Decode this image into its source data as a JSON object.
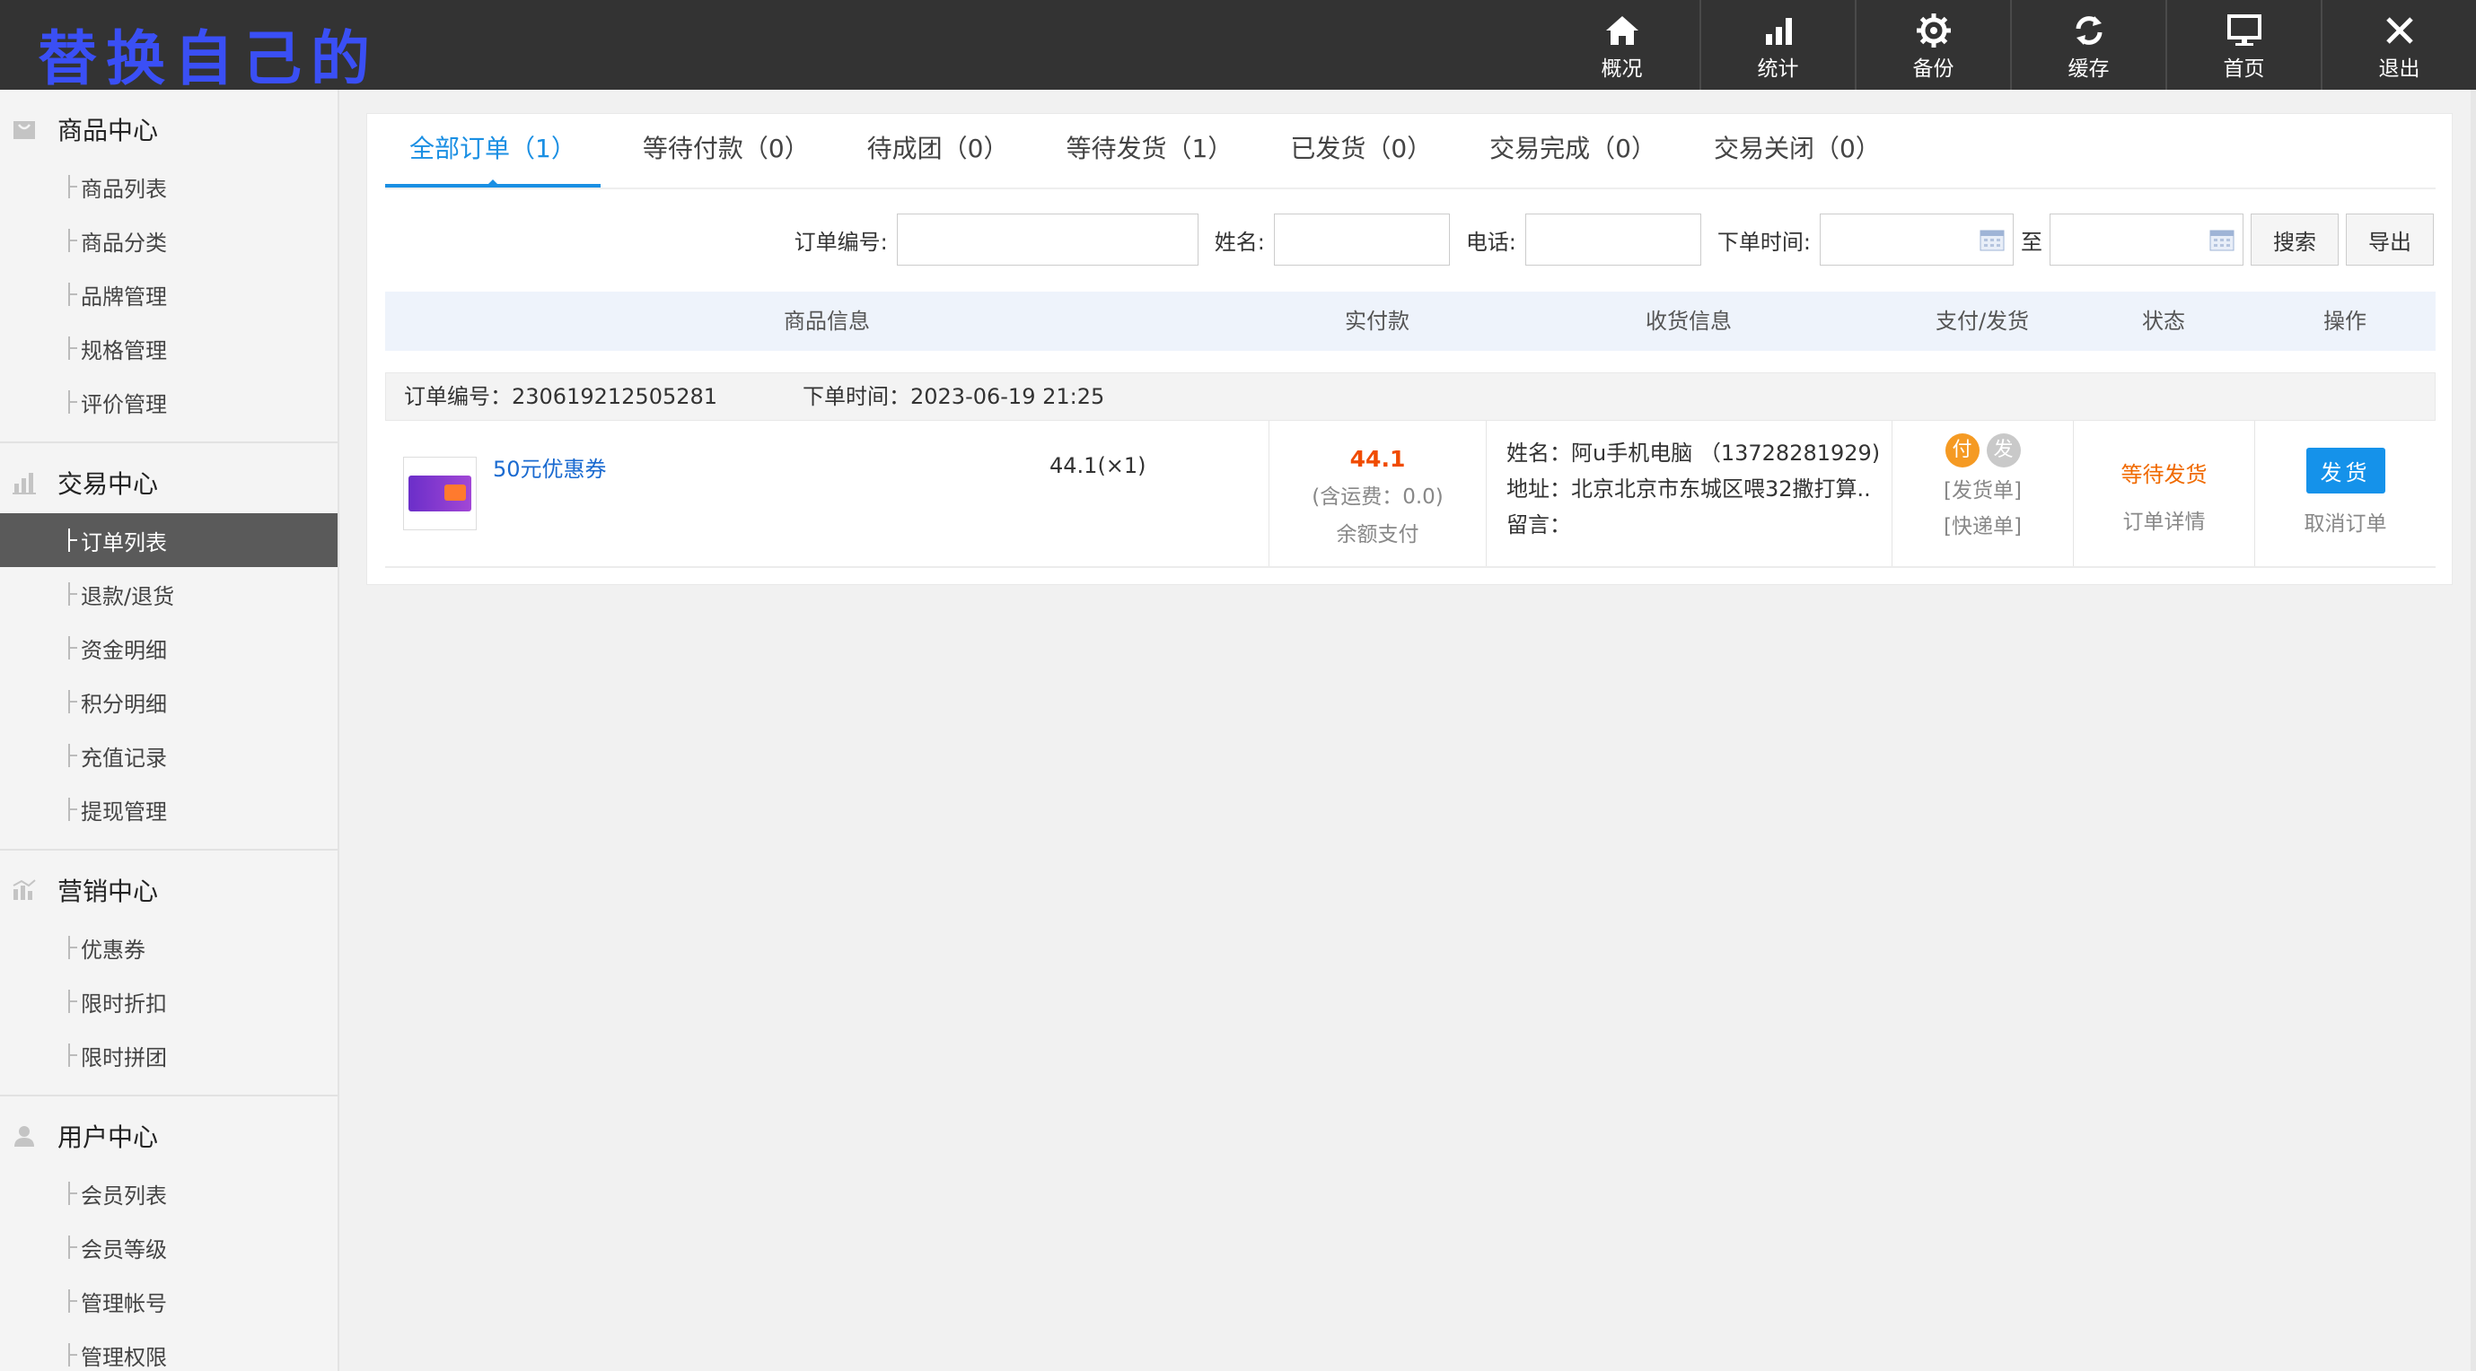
{
  "header": {
    "logo_text": "替换自己的",
    "nav": [
      {
        "label": "概况",
        "icon": "home-icon"
      },
      {
        "label": "统计",
        "icon": "bar-chart-icon"
      },
      {
        "label": "备份",
        "icon": "gear-icon"
      },
      {
        "label": "缓存",
        "icon": "refresh-icon"
      },
      {
        "label": "首页",
        "icon": "monitor-icon"
      },
      {
        "label": "退出",
        "icon": "close-icon"
      }
    ]
  },
  "sidebar": {
    "groups": [
      {
        "title": "商品中心",
        "icon": "shopping-bag-icon",
        "items": [
          "商品列表",
          "商品分类",
          "品牌管理",
          "规格管理",
          "评价管理"
        ]
      },
      {
        "title": "交易中心",
        "icon": "bar-chart-icon",
        "items": [
          "订单列表",
          "退款/退货",
          "资金明细",
          "积分明细",
          "充值记录",
          "提现管理"
        ]
      },
      {
        "title": "营销中心",
        "icon": "marketing-icon",
        "items": [
          "优惠券",
          "限时折扣",
          "限时拼团"
        ]
      },
      {
        "title": "用户中心",
        "icon": "user-icon",
        "items": [
          "会员列表",
          "会员等级",
          "管理帐号",
          "管理权限"
        ]
      }
    ],
    "active_item": "订单列表"
  },
  "tabs": [
    "全部订单（1）",
    "等待付款（0）",
    "待成团（0）",
    "等待发货（1）",
    "已发货（0）",
    "交易完成（0）",
    "交易关闭（0）"
  ],
  "filters": {
    "order_no_label": "订单编号:",
    "name_label": "姓名:",
    "phone_label": "电话:",
    "time_label": "下单时间:",
    "to_label": "至",
    "order_no_value": "",
    "name_value": "",
    "phone_value": "",
    "time_from_value": "",
    "time_to_value": "",
    "search_button": "搜索",
    "export_button": "导出"
  },
  "table": {
    "columns": [
      "商品信息",
      "实付款",
      "收货信息",
      "支付/发货",
      "状态",
      "操作"
    ]
  },
  "order": {
    "order_no_text": "订单编号：230619212505281",
    "time_text": "下单时间：2023-06-19 21:25",
    "product_name": "50元优惠券",
    "qty_text": "44.1(×1)",
    "amount": "44.1",
    "shipping_fee": "(含运费：0.0)",
    "pay_method": "余额支付",
    "recv_name": "姓名：阿u手机电脑 （13728281929)",
    "recv_addr": "地址：北京北京市东城区喂32撒打算..",
    "recv_note": "留言：",
    "pay_badge": "付",
    "ship_badge": "发",
    "pay_badge_color": "#f59a23",
    "ship_badge_color": "#c9c9c9",
    "ship_doc": "[发货单]",
    "express_doc": "[快递单]",
    "status": "等待发货",
    "detail_link": "订单详情",
    "ship_button": "发货",
    "cancel_link": "取消订单"
  }
}
